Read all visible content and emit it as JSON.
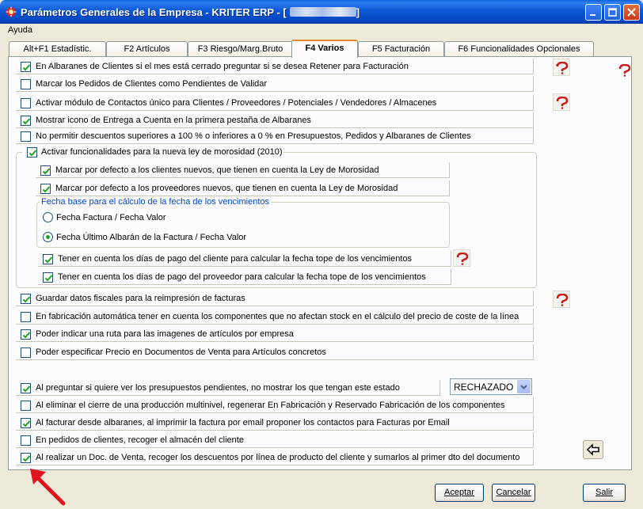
{
  "window": {
    "title": "Parámetros Generales de la Empresa - KRITER ERP - [",
    "title_suffix": "]"
  },
  "menu": {
    "help": "Ayuda"
  },
  "tabs": [
    {
      "label": "Alt+F1 Estadístic."
    },
    {
      "label": "F2 Artículos"
    },
    {
      "label": "F3 Riesgo/Marg.Bruto"
    },
    {
      "label": "F4 Varios"
    },
    {
      "label": "F5 Facturación"
    },
    {
      "label": "F6 Funcionalidades Opcionales"
    }
  ],
  "options": [
    {
      "label": "En Albaranes de Clientes si el mes está cerrado preguntar si se desea Retener para Facturación",
      "checked": true
    },
    {
      "label": "Marcar los Pedidos de Clientes como Pendientes de Validar",
      "checked": false
    },
    {
      "label": "Activar módulo de Contactos único para Clientes / Proveedores / Potenciales / Vendedores / Almacenes",
      "checked": false
    },
    {
      "label": "Mostrar icono de Entrega a Cuenta en la primera pestaña de Albaranes",
      "checked": true
    },
    {
      "label": "No permitir descuentos superiores a 100 % o inferiores a 0 % en Presupuestos, Pedidos y Albaranes de Clientes",
      "checked": false
    }
  ],
  "morosidad": {
    "label": "Activar funcionalidades para la nueva ley de morosidad (2010)",
    "checked": true,
    "sub": [
      {
        "label": "Marcar por defecto a los clientes nuevos, que tienen en cuenta la Ley de Morosidad",
        "checked": true
      },
      {
        "label": "Marcar por defecto a los proveedores nuevos, que tienen en cuenta la Ley de Morosidad",
        "checked": true
      }
    ],
    "fecha_base": {
      "title": "Fecha base para el cálculo de la fecha de los vencimientos",
      "options": [
        {
          "label": "Fecha Factura / Fecha Valor",
          "selected": false
        },
        {
          "label": "Fecha Último Albarán de la Factura / Fecha Valor",
          "selected": true
        }
      ]
    },
    "dias_pago": [
      {
        "label": "Tener en cuenta los días de pago del cliente para calcular la fecha tope de los vencimientos",
        "checked": true
      },
      {
        "label": "Tener en cuenta los días de pago del proveedor para calcular la fecha tope de los vencimientos",
        "checked": true
      }
    ]
  },
  "options2": [
    {
      "label": "Guardar datos fiscales para la reimpresión de facturas",
      "checked": true
    },
    {
      "label": "En fabricación automática tener en cuenta los componentes que no afectan stock en el cálculo del precio de coste de la línea",
      "checked": false
    },
    {
      "label": "Poder indicar una ruta para las imagenes de artículos por empresa",
      "checked": true
    },
    {
      "label": "Poder especificar Precio en Documentos de Venta para Artículos concretos",
      "checked": false
    }
  ],
  "options3": [
    {
      "label": "Al preguntar si quiere ver los presupuestos pendientes, no mostrar los que tengan este estado",
      "checked": true
    },
    {
      "label": "Al eliminar el cierre de una producción multinivel, regenerar En Fabricación y Reservado Fabricación de los componentes",
      "checked": false
    },
    {
      "label": "Al facturar desde albaranes, al imprimir la factura por email proponer los contactos para Facturas por Email",
      "checked": true
    },
    {
      "label": "En pedidos de clientes, recoger el almacén del cliente",
      "checked": false
    },
    {
      "label": "Al realizar un Doc. de Venta, recoger los descuentos por línea de producto del cliente y sumarlos al primer dto del documento",
      "checked": true
    }
  ],
  "estado_select": {
    "value": "RECHAZADO"
  },
  "buttons": {
    "accept": "Aceptar",
    "cancel": "Cancelar",
    "exit": "Salir"
  },
  "colors": {
    "titlebar": "#0b58d6",
    "tab_active_accent": "#e68b2c",
    "group_title": "#0046d5",
    "checkmark": "#21a121",
    "annotation_arrow": "#e0141e"
  }
}
